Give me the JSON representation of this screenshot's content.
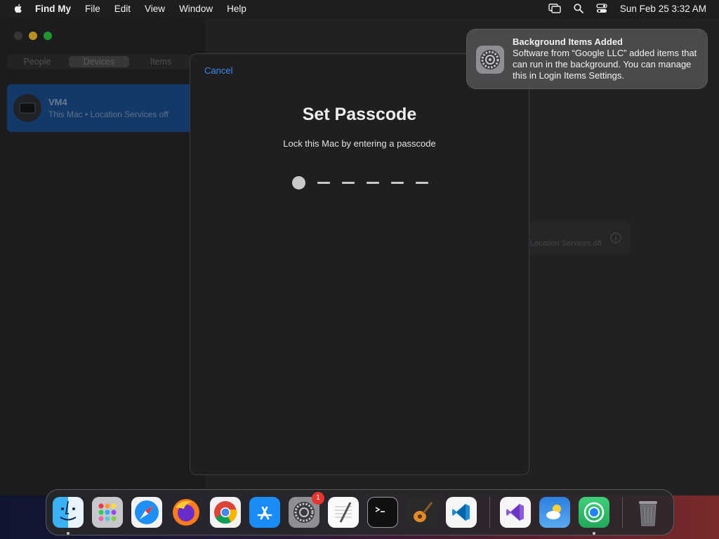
{
  "menubar": {
    "app_name": "Find My",
    "menus": [
      "File",
      "Edit",
      "View",
      "Window",
      "Help"
    ],
    "clock": "Sun Feb 25  3:32 AM"
  },
  "sidebar": {
    "tabs": [
      "People",
      "Devices",
      "Items"
    ],
    "active_tab": "Devices",
    "device": {
      "name": "VM4",
      "subtitle": "This Mac • Location Services off"
    }
  },
  "detail_card": {
    "text": "Location Services off"
  },
  "sheet": {
    "cancel_label": "Cancel",
    "title": "Set Passcode",
    "subtitle": "Lock this Mac by entering a passcode",
    "digits_entered": 1,
    "digits_total": 6
  },
  "notification": {
    "title": "Background Items Added",
    "body": "Software from “Google LLC” added items that can run in the background. You can manage this in Login Items Settings."
  },
  "dock": {
    "items": [
      {
        "name": "finder-icon",
        "running": true
      },
      {
        "name": "launchpad-icon",
        "running": false
      },
      {
        "name": "safari-icon",
        "running": false
      },
      {
        "name": "firefox-icon",
        "running": false
      },
      {
        "name": "chrome-icon",
        "running": false
      },
      {
        "name": "app-store-icon",
        "running": false
      },
      {
        "name": "system-settings-icon",
        "running": false,
        "badge": "1"
      },
      {
        "name": "textedit-icon",
        "running": false
      },
      {
        "name": "terminal-icon",
        "running": false
      },
      {
        "name": "garageband-icon",
        "running": false
      },
      {
        "name": "vscode-icon",
        "running": false
      },
      {
        "name": "visual-studio-icon",
        "running": false
      },
      {
        "name": "weather-icon",
        "running": false
      },
      {
        "name": "find-my-icon",
        "running": true
      },
      {
        "name": "trash-icon",
        "running": false
      }
    ]
  },
  "colors": {
    "accent": "#3a8bf0",
    "selection": "#1a4c8c",
    "traffic_close": "#4a4a4c",
    "traffic_min": "#f5bf2f",
    "traffic_max": "#2bc840"
  }
}
